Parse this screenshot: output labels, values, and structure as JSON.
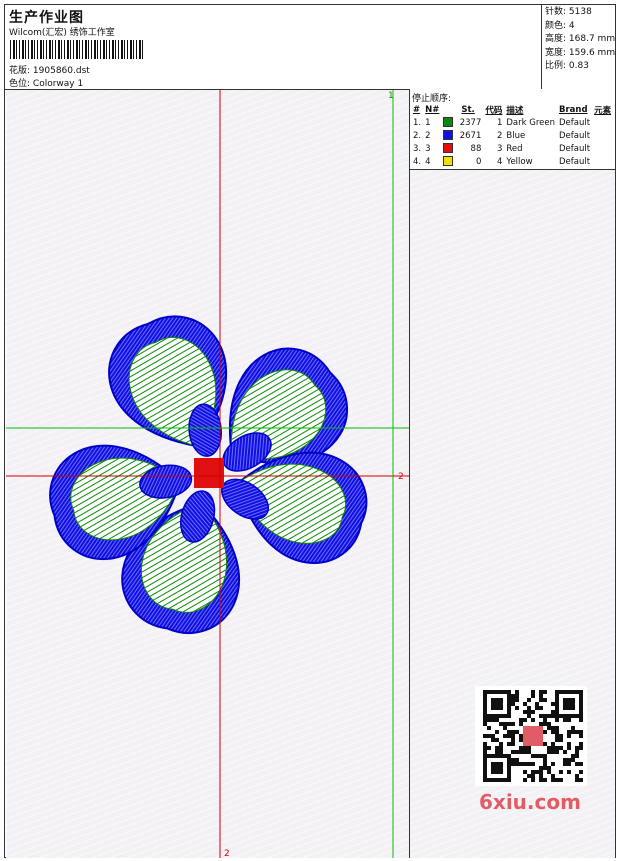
{
  "header": {
    "title": "生产作业图",
    "subtitle": "Wilcom(汇宏) 绣饰工作室",
    "file_label": "花版:",
    "file_name": "1905860.dst",
    "color_label": "色位:",
    "color_name": "Colorway 1"
  },
  "stats": [
    {
      "label": "针数:",
      "value": "5138"
    },
    {
      "label": "颜色:",
      "value": "4"
    },
    {
      "label": "高度:",
      "value": "168.7 mm"
    },
    {
      "label": "宽度:",
      "value": "159.6 mm"
    },
    {
      "label": "比例:",
      "value": "0.83"
    }
  ],
  "stop_sequence": {
    "title": "停止顺序:",
    "columns": [
      "#",
      "N#",
      "St.",
      "代码",
      "描述",
      "Brand",
      "元素"
    ],
    "rows": [
      {
        "idx": "1.",
        "n": "1",
        "color": "#0a8a0a",
        "stitches": "2377",
        "code": "1",
        "desc": "Dark Green",
        "brand": "Default"
      },
      {
        "idx": "2.",
        "n": "2",
        "color": "#1010e0",
        "stitches": "2671",
        "code": "2",
        "desc": "Blue",
        "brand": "Default"
      },
      {
        "idx": "3.",
        "n": "3",
        "color": "#e01010",
        "stitches": "88",
        "code": "3",
        "desc": "Red",
        "brand": "Default"
      },
      {
        "idx": "4.",
        "n": "4",
        "color": "#f0e000",
        "stitches": "0",
        "code": "4",
        "desc": "Yellow",
        "brand": "Default"
      }
    ]
  },
  "markers": {
    "top_green": "1",
    "right_red": "2",
    "bottom_red": "2"
  },
  "watermark": "6xiu.com",
  "colors": {
    "green": "#0a8a0a",
    "blue": "#1010e0",
    "red": "#e01010",
    "guide_red": "#d00000",
    "guide_green": "#00c000"
  }
}
